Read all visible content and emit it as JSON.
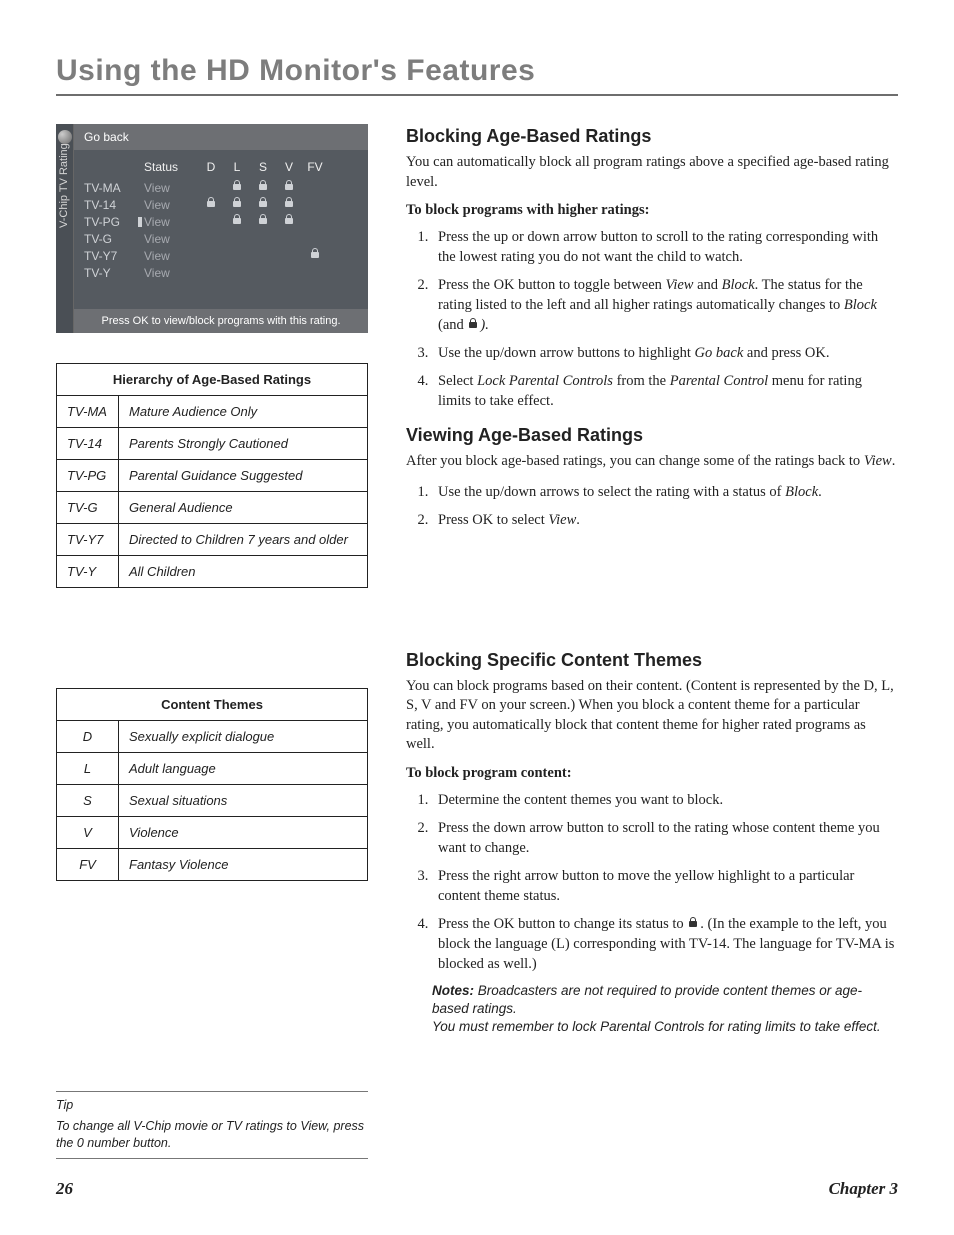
{
  "chapter_title": "Using the HD Monitor's Features",
  "vchip": {
    "side_label": "V-Chip TV Rating",
    "go_back": "Go back",
    "headers": {
      "status": "Status",
      "d": "D",
      "l": "L",
      "s": "S",
      "v": "V",
      "fv": "FV"
    },
    "rows": [
      {
        "rating": "TV-MA",
        "status": "View",
        "locks": {
          "d": false,
          "l": true,
          "s": true,
          "v": true,
          "fv": false
        },
        "cursor": false
      },
      {
        "rating": "TV-14",
        "status": "View",
        "locks": {
          "d": true,
          "l": true,
          "s": true,
          "v": true,
          "fv": false
        },
        "cursor": false
      },
      {
        "rating": "TV-PG",
        "status": "View",
        "locks": {
          "d": false,
          "l": true,
          "s": true,
          "v": true,
          "fv": false
        },
        "cursor": true
      },
      {
        "rating": "TV-G",
        "status": "View",
        "locks": {
          "d": false,
          "l": false,
          "s": false,
          "v": false,
          "fv": false
        },
        "cursor": false
      },
      {
        "rating": "TV-Y7",
        "status": "View",
        "locks": {
          "d": false,
          "l": false,
          "s": false,
          "v": false,
          "fv": true
        },
        "cursor": false
      },
      {
        "rating": "TV-Y",
        "status": "View",
        "locks": {
          "d": false,
          "l": false,
          "s": false,
          "v": false,
          "fv": false
        },
        "cursor": false
      }
    ],
    "footer": "Press OK to view/block programs with this rating."
  },
  "hierarchy_table": {
    "title": "Hierarchy of Age-Based Ratings",
    "rows": [
      {
        "code": "TV-MA",
        "desc": "Mature Audience Only"
      },
      {
        "code": "TV-14",
        "desc": "Parents Strongly Cautioned"
      },
      {
        "code": "TV-PG",
        "desc": "Parental Guidance Suggested"
      },
      {
        "code": "TV-G",
        "desc": "General Audience"
      },
      {
        "code": "TV-Y7",
        "desc": "Directed to Children 7 years and older"
      },
      {
        "code": "TV-Y",
        "desc": "All Children"
      }
    ]
  },
  "themes_table": {
    "title": "Content Themes",
    "rows": [
      {
        "code": "D",
        "desc": "Sexually explicit dialogue"
      },
      {
        "code": "L",
        "desc": "Adult language"
      },
      {
        "code": "S",
        "desc": "Sexual situations"
      },
      {
        "code": "V",
        "desc": "Violence"
      },
      {
        "code": "FV",
        "desc": "Fantasy Violence"
      }
    ]
  },
  "section1": {
    "heading": "Blocking Age-Based Ratings",
    "intro": "You can automatically block all program ratings above a specified age-based rating level.",
    "subhead": "To block programs with higher ratings:",
    "steps": {
      "s1": "Press the up or down arrow button to scroll to the rating corresponding with the lowest rating you do not want the child to watch.",
      "s2a": "Press the OK button to toggle between ",
      "s2_view": "View",
      "s2_and": " and ",
      "s2_block": "Block",
      "s2b": ". The status for the rating listed to the left and all higher ratings automatically changes to ",
      "s2_block2": "Block",
      "s2c": " (and ",
      "s2d": ").",
      "s3a": "Use the up/down arrow buttons to highlight ",
      "s3_goback": "Go back",
      "s3b": " and press OK.",
      "s4a": "Select ",
      "s4_lock": "Lock Parental Controls",
      "s4b": " from the ",
      "s4_menu": "Parental Control",
      "s4c": " menu for rating limits to take effect."
    }
  },
  "section2": {
    "heading": "Viewing Age-Based Ratings",
    "intro_a": "After you block age-based ratings, you can change some of the ratings back to ",
    "intro_view": "View",
    "intro_b": ".",
    "steps": {
      "s1a": "Use the up/down arrows to select the rating with a status of ",
      "s1_block": "Block",
      "s1b": ".",
      "s2a": "Press OK to select ",
      "s2_view": "View",
      "s2b": "."
    }
  },
  "section3": {
    "heading": "Blocking Specific Content Themes",
    "intro": "You can block programs based on their content. (Content is represented by the D, L, S, V and FV on your screen.) When you block a content theme for a particular rating, you automatically block that content theme for higher rated programs as well.",
    "subhead": "To block program content:",
    "steps": {
      "s1": "Determine the content themes you want to block.",
      "s2": "Press the down arrow button to scroll to the rating whose content theme you want to change.",
      "s3": "Press the right arrow button to move the yellow highlight to a particular content theme status.",
      "s4a": "Press the OK button to change its status to ",
      "s4b": ". (In the example to the left, you block the language (L) corresponding with TV-14. The language for TV-MA is blocked as well.)"
    },
    "notes_label": "Notes:",
    "note1": " Broadcasters are not required to provide content themes or age-based ratings.",
    "note2": "You must remember to lock Parental Controls for rating limits to take effect."
  },
  "tip": {
    "label": "Tip",
    "body": "To change all V-Chip movie or TV ratings to View, press the 0 number button."
  },
  "footer": {
    "page": "26",
    "chapter": "Chapter 3"
  }
}
